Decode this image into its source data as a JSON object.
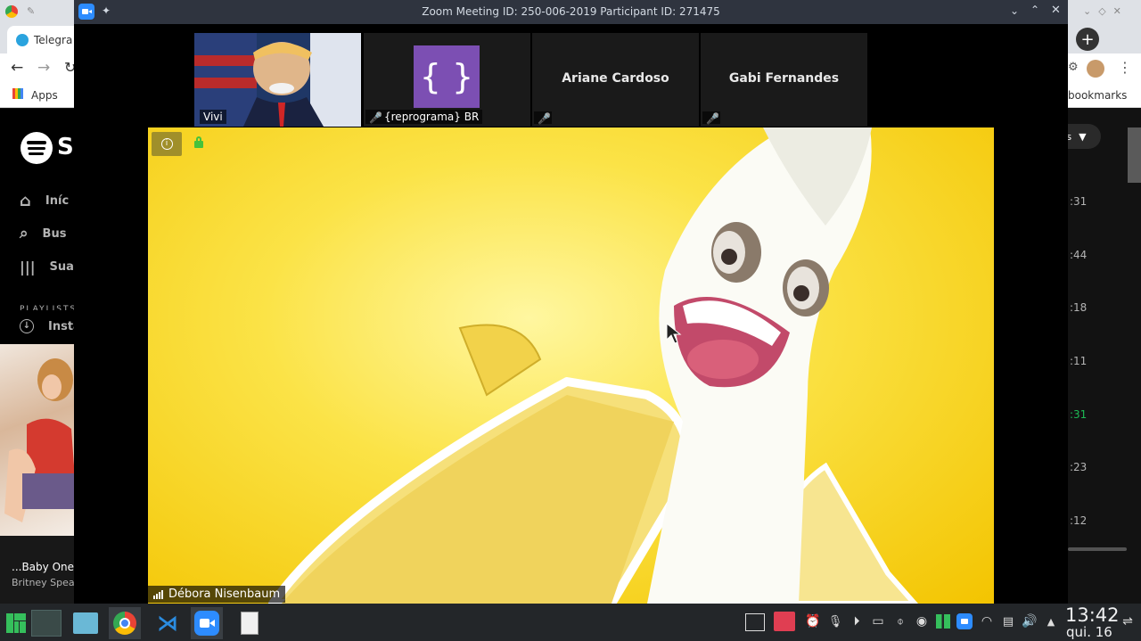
{
  "browser": {
    "tab_title": "Telegra",
    "bookmarks_apps": "Apps",
    "bookmarks_right": "bookmarks"
  },
  "spotify": {
    "logo_text": "Sp",
    "nav": [
      {
        "label": "Iníc",
        "icon": "home-icon"
      },
      {
        "label": "Bus",
        "icon": "search-icon"
      },
      {
        "label": "Sua",
        "icon": "library-icon"
      }
    ],
    "section_label": "PLAYLISTS",
    "install_label": "Insta",
    "now_playing_title": "...Baby One",
    "now_playing_artist": "Britney Spear",
    "dropdown_text": "s",
    "durations": [
      ":31",
      ":44",
      ":18",
      ":11",
      ":31",
      ":23",
      ":12"
    ],
    "active_duration_index": 4,
    "accent_color": "#1db954"
  },
  "zoom": {
    "window_title": "Zoom Meeting ID: 250-006-2019 Participant ID: 271475",
    "participants": [
      {
        "name": "Vivi",
        "muted": false,
        "has_video": true
      },
      {
        "name": "{reprograma} BR",
        "muted": true,
        "has_video": false,
        "logo_text": "{ }",
        "logo_color": "#7c4fb3"
      },
      {
        "name": "Ariane Cardoso",
        "muted": true,
        "has_video": false
      },
      {
        "name": "Gabi Fernandes",
        "muted": true,
        "has_video": false
      }
    ],
    "active_speaker": "Débora Nisenbaum",
    "window_controls": [
      "chevron-down-icon",
      "chevron-up-icon",
      "close-icon"
    ]
  },
  "taskbar": {
    "time": "13:42",
    "date": "qui. 16"
  }
}
